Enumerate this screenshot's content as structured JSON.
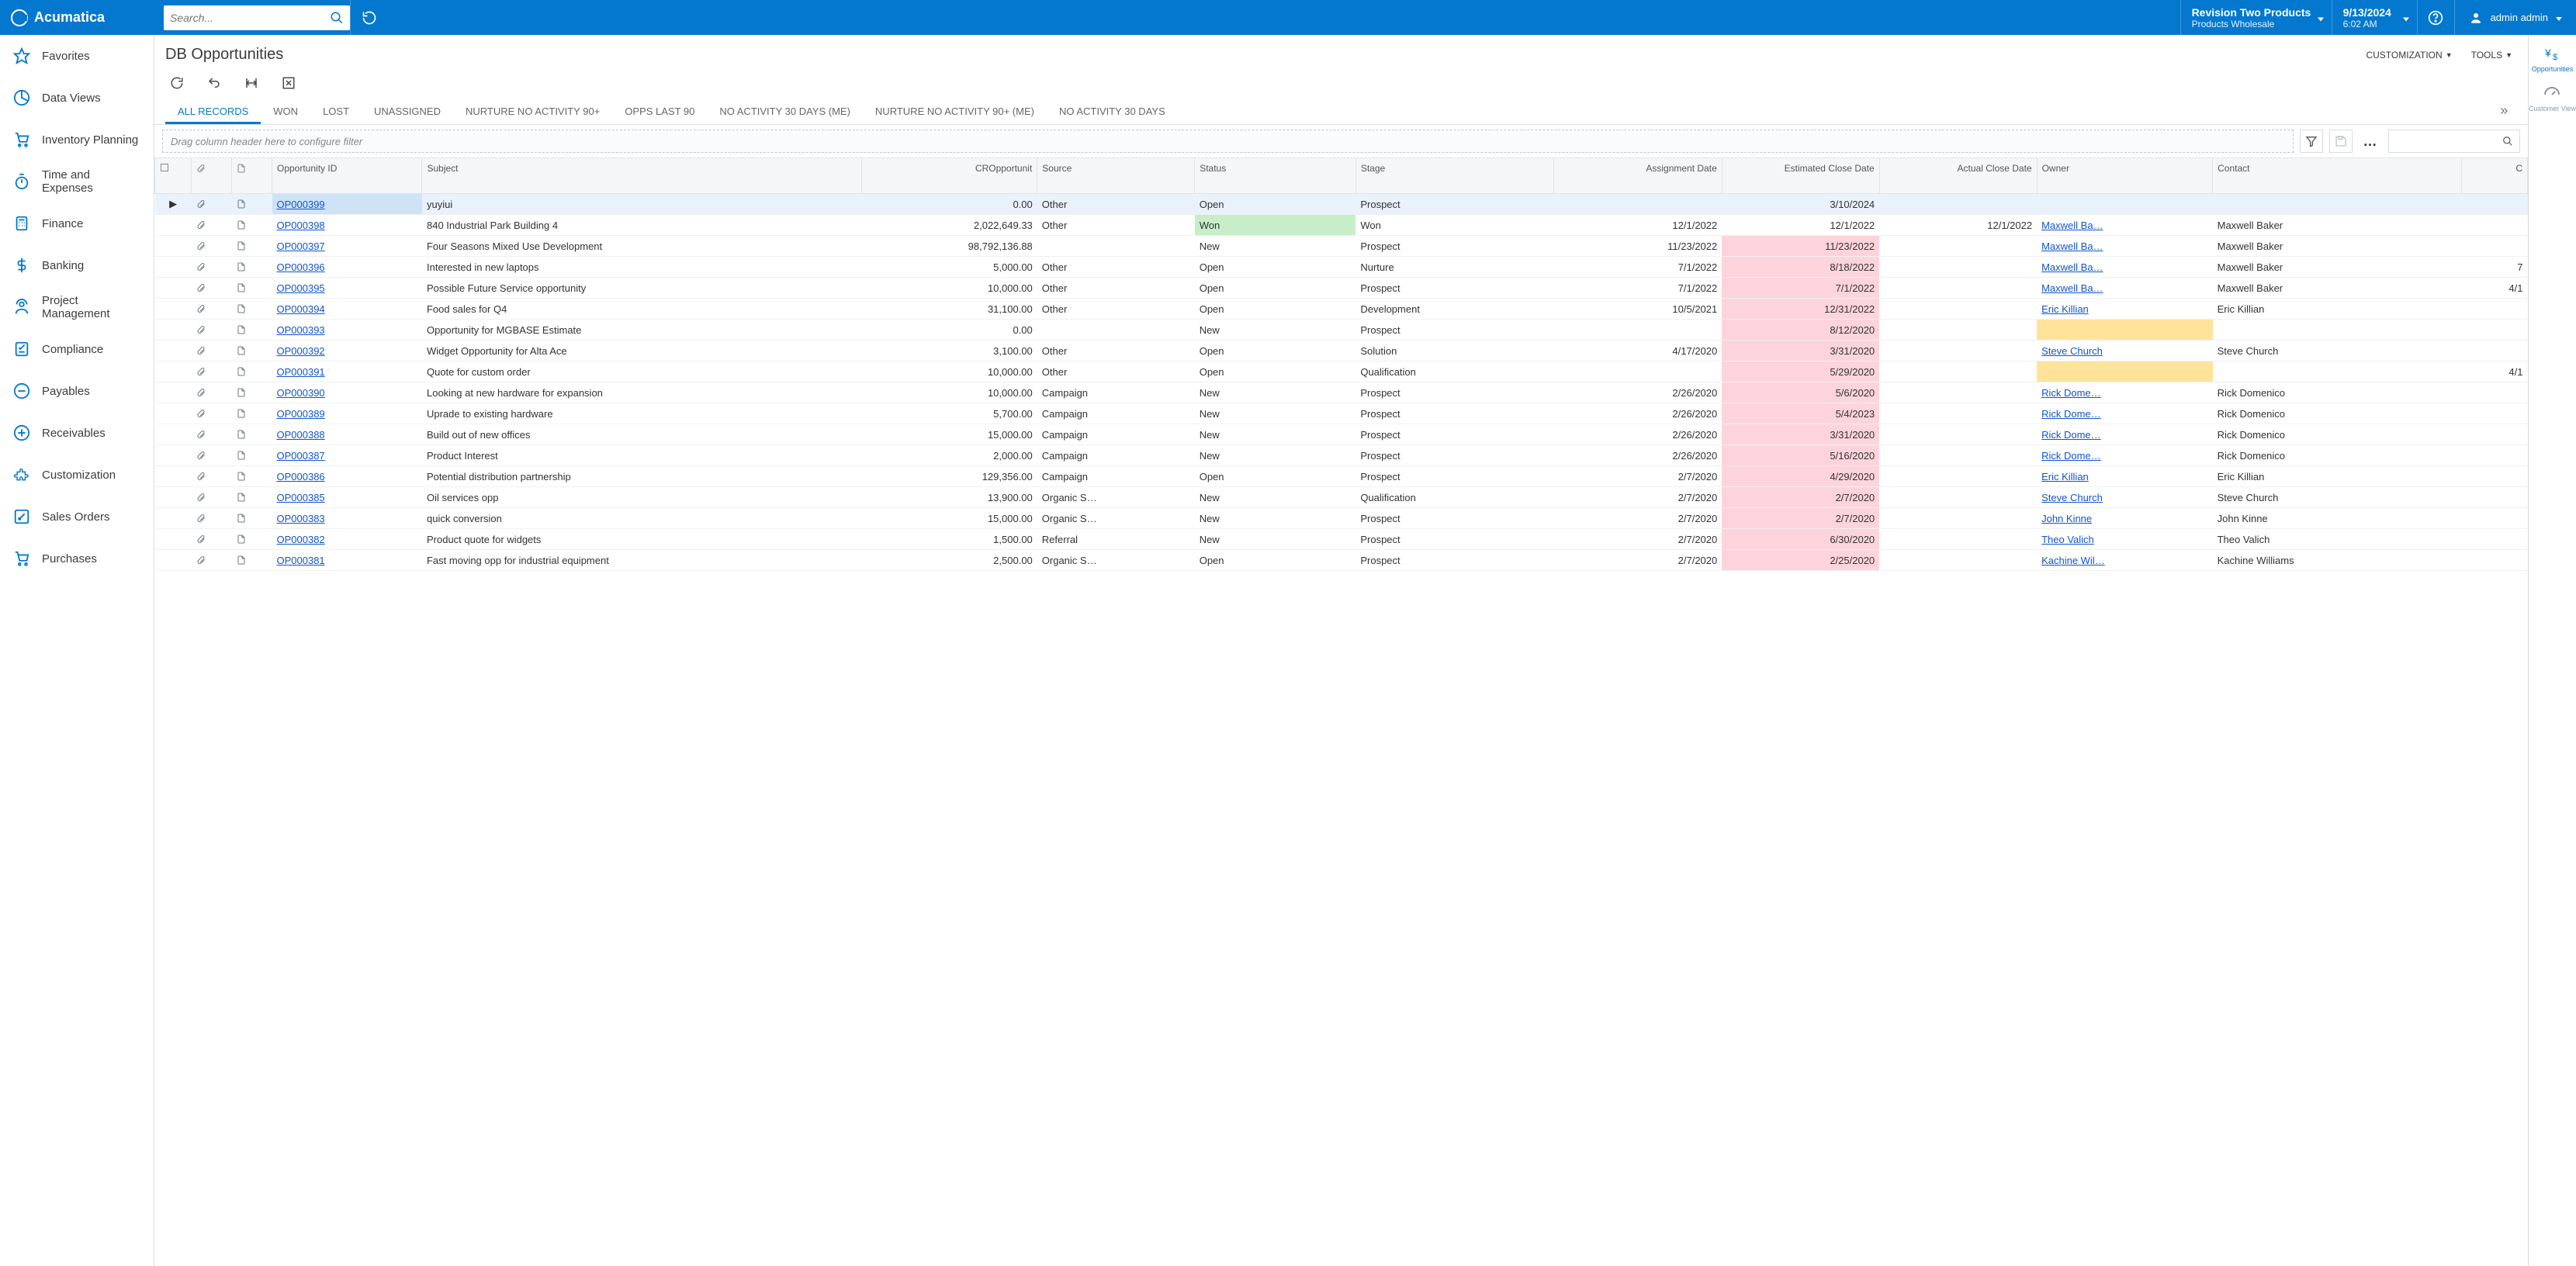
{
  "brand": "Acumatica",
  "search": {
    "placeholder": "Search..."
  },
  "org": {
    "line1": "Revision Two Products",
    "line2": "Products Wholesale"
  },
  "datetime": {
    "line1": "9/13/2024",
    "line2": "6:02 AM"
  },
  "user": {
    "name": "admin admin"
  },
  "nav": {
    "items": [
      {
        "label": "Favorites",
        "icon": "star"
      },
      {
        "label": "Data Views",
        "icon": "pie"
      },
      {
        "label": "Inventory Planning",
        "icon": "cart"
      },
      {
        "label": "Time and Expenses",
        "icon": "stopwatch"
      },
      {
        "label": "Finance",
        "icon": "calc"
      },
      {
        "label": "Banking",
        "icon": "dollar"
      },
      {
        "label": "Project Management",
        "icon": "worker"
      },
      {
        "label": "Compliance",
        "icon": "checklist"
      },
      {
        "label": "Payables",
        "icon": "minus"
      },
      {
        "label": "Receivables",
        "icon": "plus"
      },
      {
        "label": "Customization",
        "icon": "puzzle"
      },
      {
        "label": "Sales Orders",
        "icon": "pencilbox"
      },
      {
        "label": "Purchases",
        "icon": "cart2"
      }
    ]
  },
  "page": {
    "title": "DB Opportunities",
    "actions": {
      "customization": "CUSTOMIZATION",
      "tools": "TOOLS"
    }
  },
  "tabs": [
    "ALL RECORDS",
    "WON",
    "LOST",
    "UNASSIGNED",
    "NURTURE NO ACTIVITY 90+",
    "OPPS LAST 90",
    "NO ACTIVITY 30 DAYS (ME)",
    "NURTURE NO ACTIVITY 90+ (ME)",
    "NO ACTIVITY 30 DAYS"
  ],
  "filter": {
    "hint": "Drag column header here to configure filter"
  },
  "rightrail": [
    {
      "label": "Opportunities",
      "icon": "yen-dollar",
      "active": true
    },
    {
      "label": "Customer View",
      "icon": "gauge",
      "active": false
    }
  ],
  "grid": {
    "columns": [
      "Opportunity ID",
      "Subject",
      "CROpportunit",
      "Source",
      "Status",
      "Stage",
      "Assignment Date",
      "Estimated Close Date",
      "Actual Close Date",
      "Owner",
      "Contact",
      "C"
    ],
    "rows": [
      {
        "id": "OP000399",
        "subject": "yuyiui",
        "amount": "0.00",
        "source": "Other",
        "status": "Open",
        "stage": "Prospect",
        "assign": "",
        "est": "3/10/2024",
        "estHl": "red",
        "actual": "",
        "owner": "",
        "ownerHl": "amber",
        "contact": "",
        "c": "",
        "selected": true
      },
      {
        "id": "OP000398",
        "subject": "840 Industrial Park Building 4",
        "amount": "2,022,649.33",
        "source": "Other",
        "status": "Won",
        "statusHl": "green",
        "stage": "Won",
        "assign": "12/1/2022",
        "est": "12/1/2022",
        "actual": "12/1/2022",
        "owner": "Maxwell Ba…",
        "contact": "Maxwell Baker",
        "c": ""
      },
      {
        "id": "OP000397",
        "subject": "Four Seasons Mixed Use Development",
        "amount": "98,792,136.88",
        "source": "",
        "status": "New",
        "stage": "Prospect",
        "assign": "11/23/2022",
        "est": "11/23/2022",
        "estHl": "red",
        "actual": "",
        "owner": "Maxwell Ba…",
        "contact": "Maxwell Baker",
        "c": ""
      },
      {
        "id": "OP000396",
        "subject": "Interested in new laptops",
        "amount": "5,000.00",
        "source": "Other",
        "status": "Open",
        "stage": "Nurture",
        "assign": "7/1/2022",
        "est": "8/18/2022",
        "estHl": "red",
        "actual": "",
        "owner": "Maxwell Ba…",
        "contact": "Maxwell Baker",
        "c": "7"
      },
      {
        "id": "OP000395",
        "subject": "Possible Future Service opportunity",
        "amount": "10,000.00",
        "source": "Other",
        "status": "Open",
        "stage": "Prospect",
        "assign": "7/1/2022",
        "est": "7/1/2022",
        "estHl": "red",
        "actual": "",
        "owner": "Maxwell Ba…",
        "contact": "Maxwell Baker",
        "c": "4/1"
      },
      {
        "id": "OP000394",
        "subject": "Food sales for Q4",
        "amount": "31,100.00",
        "source": "Other",
        "status": "Open",
        "stage": "Development",
        "assign": "10/5/2021",
        "est": "12/31/2022",
        "estHl": "red",
        "actual": "",
        "owner": "Eric Killian",
        "contact": "Eric Killian",
        "c": ""
      },
      {
        "id": "OP000393",
        "subject": "Opportunity for MGBASE Estimate",
        "amount": "0.00",
        "source": "",
        "status": "New",
        "stage": "Prospect",
        "assign": "",
        "est": "8/12/2020",
        "estHl": "red",
        "actual": "",
        "owner": "",
        "ownerHl": "amber",
        "contact": "",
        "c": ""
      },
      {
        "id": "OP000392",
        "subject": "Widget Opportunity for Alta Ace",
        "amount": "3,100.00",
        "source": "Other",
        "status": "Open",
        "stage": "Solution",
        "assign": "4/17/2020",
        "est": "3/31/2020",
        "estHl": "red",
        "actual": "",
        "owner": "Steve Church",
        "contact": "Steve Church",
        "c": ""
      },
      {
        "id": "OP000391",
        "subject": "Quote for custom order",
        "amount": "10,000.00",
        "source": "Other",
        "status": "Open",
        "stage": "Qualification",
        "assign": "",
        "est": "5/29/2020",
        "estHl": "red",
        "actual": "",
        "owner": "",
        "ownerHl": "amber",
        "contact": "",
        "c": "4/1"
      },
      {
        "id": "OP000390",
        "subject": "Looking at new hardware for expansion",
        "amount": "10,000.00",
        "source": "Campaign",
        "status": "New",
        "stage": "Prospect",
        "assign": "2/26/2020",
        "est": "5/6/2020",
        "estHl": "red",
        "actual": "",
        "owner": "Rick Dome…",
        "contact": "Rick Domenico",
        "c": ""
      },
      {
        "id": "OP000389",
        "subject": "Uprade to existing hardware",
        "amount": "5,700.00",
        "source": "Campaign",
        "status": "New",
        "stage": "Prospect",
        "assign": "2/26/2020",
        "est": "5/4/2023",
        "estHl": "red",
        "actual": "",
        "owner": "Rick Dome…",
        "contact": "Rick Domenico",
        "c": ""
      },
      {
        "id": "OP000388",
        "subject": "Build out of new offices",
        "amount": "15,000.00",
        "source": "Campaign",
        "status": "New",
        "stage": "Prospect",
        "assign": "2/26/2020",
        "est": "3/31/2020",
        "estHl": "red",
        "actual": "",
        "owner": "Rick Dome…",
        "contact": "Rick Domenico",
        "c": ""
      },
      {
        "id": "OP000387",
        "subject": "Product Interest",
        "amount": "2,000.00",
        "source": "Campaign",
        "status": "New",
        "stage": "Prospect",
        "assign": "2/26/2020",
        "est": "5/16/2020",
        "estHl": "red",
        "actual": "",
        "owner": "Rick Dome…",
        "contact": "Rick Domenico",
        "c": ""
      },
      {
        "id": "OP000386",
        "subject": "Potential distribution partnership",
        "amount": "129,356.00",
        "source": "Campaign",
        "status": "Open",
        "stage": "Prospect",
        "assign": "2/7/2020",
        "est": "4/29/2020",
        "estHl": "red",
        "actual": "",
        "owner": "Eric Killian",
        "contact": "Eric Killian",
        "c": ""
      },
      {
        "id": "OP000385",
        "subject": "Oil services opp",
        "amount": "13,900.00",
        "source": "Organic S…",
        "status": "New",
        "stage": "Qualification",
        "assign": "2/7/2020",
        "est": "2/7/2020",
        "estHl": "red",
        "actual": "",
        "owner": "Steve Church",
        "contact": "Steve Church",
        "c": ""
      },
      {
        "id": "OP000383",
        "subject": "quick conversion",
        "amount": "15,000.00",
        "source": "Organic S…",
        "status": "New",
        "stage": "Prospect",
        "assign": "2/7/2020",
        "est": "2/7/2020",
        "estHl": "red",
        "actual": "",
        "owner": "John Kinne",
        "contact": "John Kinne",
        "c": ""
      },
      {
        "id": "OP000382",
        "subject": "Product quote for widgets",
        "amount": "1,500.00",
        "source": "Referral",
        "status": "New",
        "stage": "Prospect",
        "assign": "2/7/2020",
        "est": "6/30/2020",
        "estHl": "red",
        "actual": "",
        "owner": "Theo Valich",
        "contact": "Theo Valich",
        "c": ""
      },
      {
        "id": "OP000381",
        "subject": "Fast moving opp for industrial equipment",
        "amount": "2,500.00",
        "source": "Organic S…",
        "status": "Open",
        "stage": "Prospect",
        "assign": "2/7/2020",
        "est": "2/25/2020",
        "estHl": "red",
        "actual": "",
        "owner": "Kachine Wil…",
        "contact": "Kachine Williams",
        "c": ""
      }
    ]
  }
}
